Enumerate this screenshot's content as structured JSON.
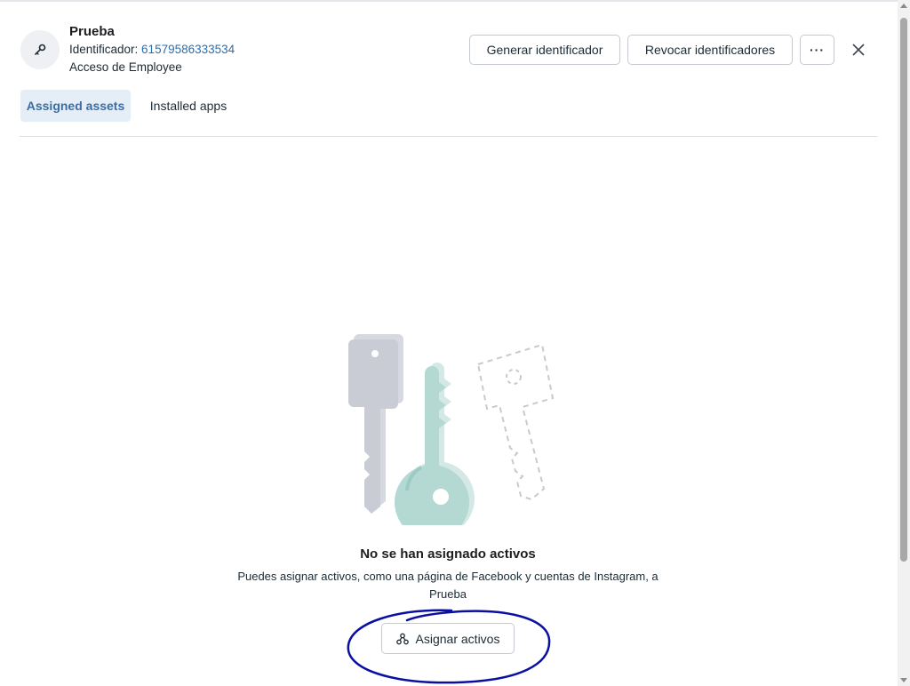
{
  "header": {
    "name": "Prueba",
    "id_label": "Identificador: ",
    "id_value": "61579586333534",
    "access": "Acceso de Employee",
    "generate_button": "Generar identificador",
    "revoke_button": "Revocar identificadores",
    "more_button": "···"
  },
  "tabs": [
    {
      "label": "Assigned assets",
      "active": true
    },
    {
      "label": "Installed apps",
      "active": false
    }
  ],
  "empty_state": {
    "title": "No se han asignado activos",
    "description": "Puedes asignar activos, como una página de Facebook y cuentas de Instagram, a Prueba",
    "assign_button": "Asignar activos"
  },
  "icons": {
    "avatar": "key-icon",
    "close": "close-icon",
    "assign": "share-nodes-icon"
  },
  "colors": {
    "accent": "#3b6ea5",
    "tab_active_bg": "#e5edf6",
    "annotation": "#0a0fa0",
    "key_gray": "#c9ccd4",
    "key_teal": "#b4d9d3"
  }
}
